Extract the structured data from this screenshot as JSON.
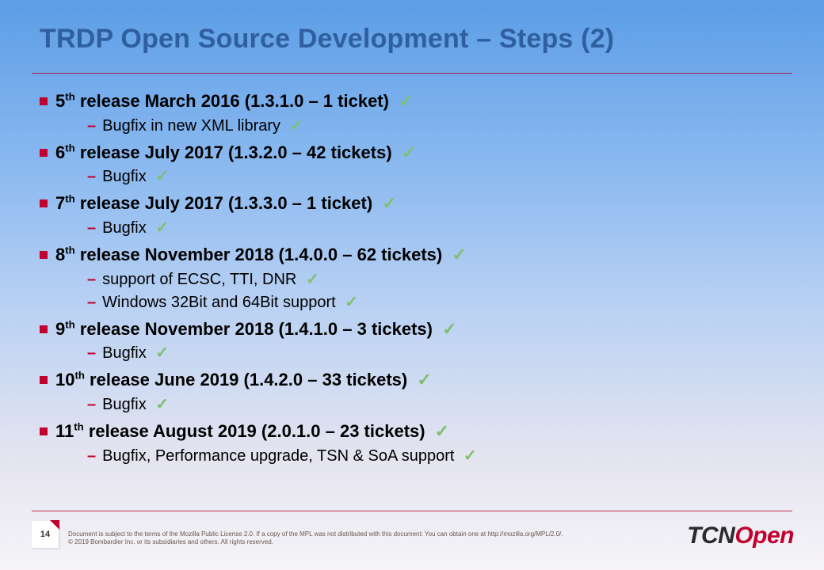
{
  "title": "TRDP Open  Source Development – Steps (2)",
  "releases": [
    {
      "ord_num": "5",
      "ord_suffix": "th",
      "rest": " release March 2016 (1.3.1.0 – 1 ticket) ",
      "subs": [
        "Bugfix in new XML library "
      ]
    },
    {
      "ord_num": "6",
      "ord_suffix": "th",
      "rest": " release July 2017 (1.3.2.0 – 42 tickets) ",
      "subs": [
        "Bugfix "
      ]
    },
    {
      "ord_num": "7",
      "ord_suffix": "th",
      "rest": " release July 2017 (1.3.3.0 – 1 ticket) ",
      "subs": [
        "Bugfix "
      ]
    },
    {
      "ord_num": "8",
      "ord_suffix": "th",
      "rest": " release November 2018 (1.4.0.0 – 62 tickets) ",
      "subs": [
        "support of  ECSC, TTI, DNR ",
        "Windows 32Bit and 64Bit support "
      ]
    },
    {
      "ord_num": "9",
      "ord_suffix": "th",
      "rest": " release November 2018 (1.4.1.0 – 3 tickets) ",
      "subs": [
        "Bugfix "
      ]
    },
    {
      "ord_num": "10",
      "ord_suffix": "th",
      "rest": " release June 2019 (1.4.2.0 – 33 tickets) ",
      "subs": [
        "Bugfix "
      ]
    },
    {
      "ord_num": "11",
      "ord_suffix": "th",
      "rest": " release August 2019 (2.0.1.0 – 23 tickets) ",
      "subs": [
        "Bugfix, Performance upgrade, TSN & SoA support "
      ]
    }
  ],
  "page_number": "14",
  "footnote_line1": "Document is subject to the terms of the Mozilla Public License 2.0. If a copy of the MPL was not distributed with this document: You can obtain one at http://mozilla.org/MPL/2.0/.",
  "footnote_line2": "© 2019 Bombardier Inc. or its subsidiaries and others. All rights reserved.",
  "logo": {
    "part1": "TCN",
    "part2": "Open"
  },
  "checkmark": "✓"
}
